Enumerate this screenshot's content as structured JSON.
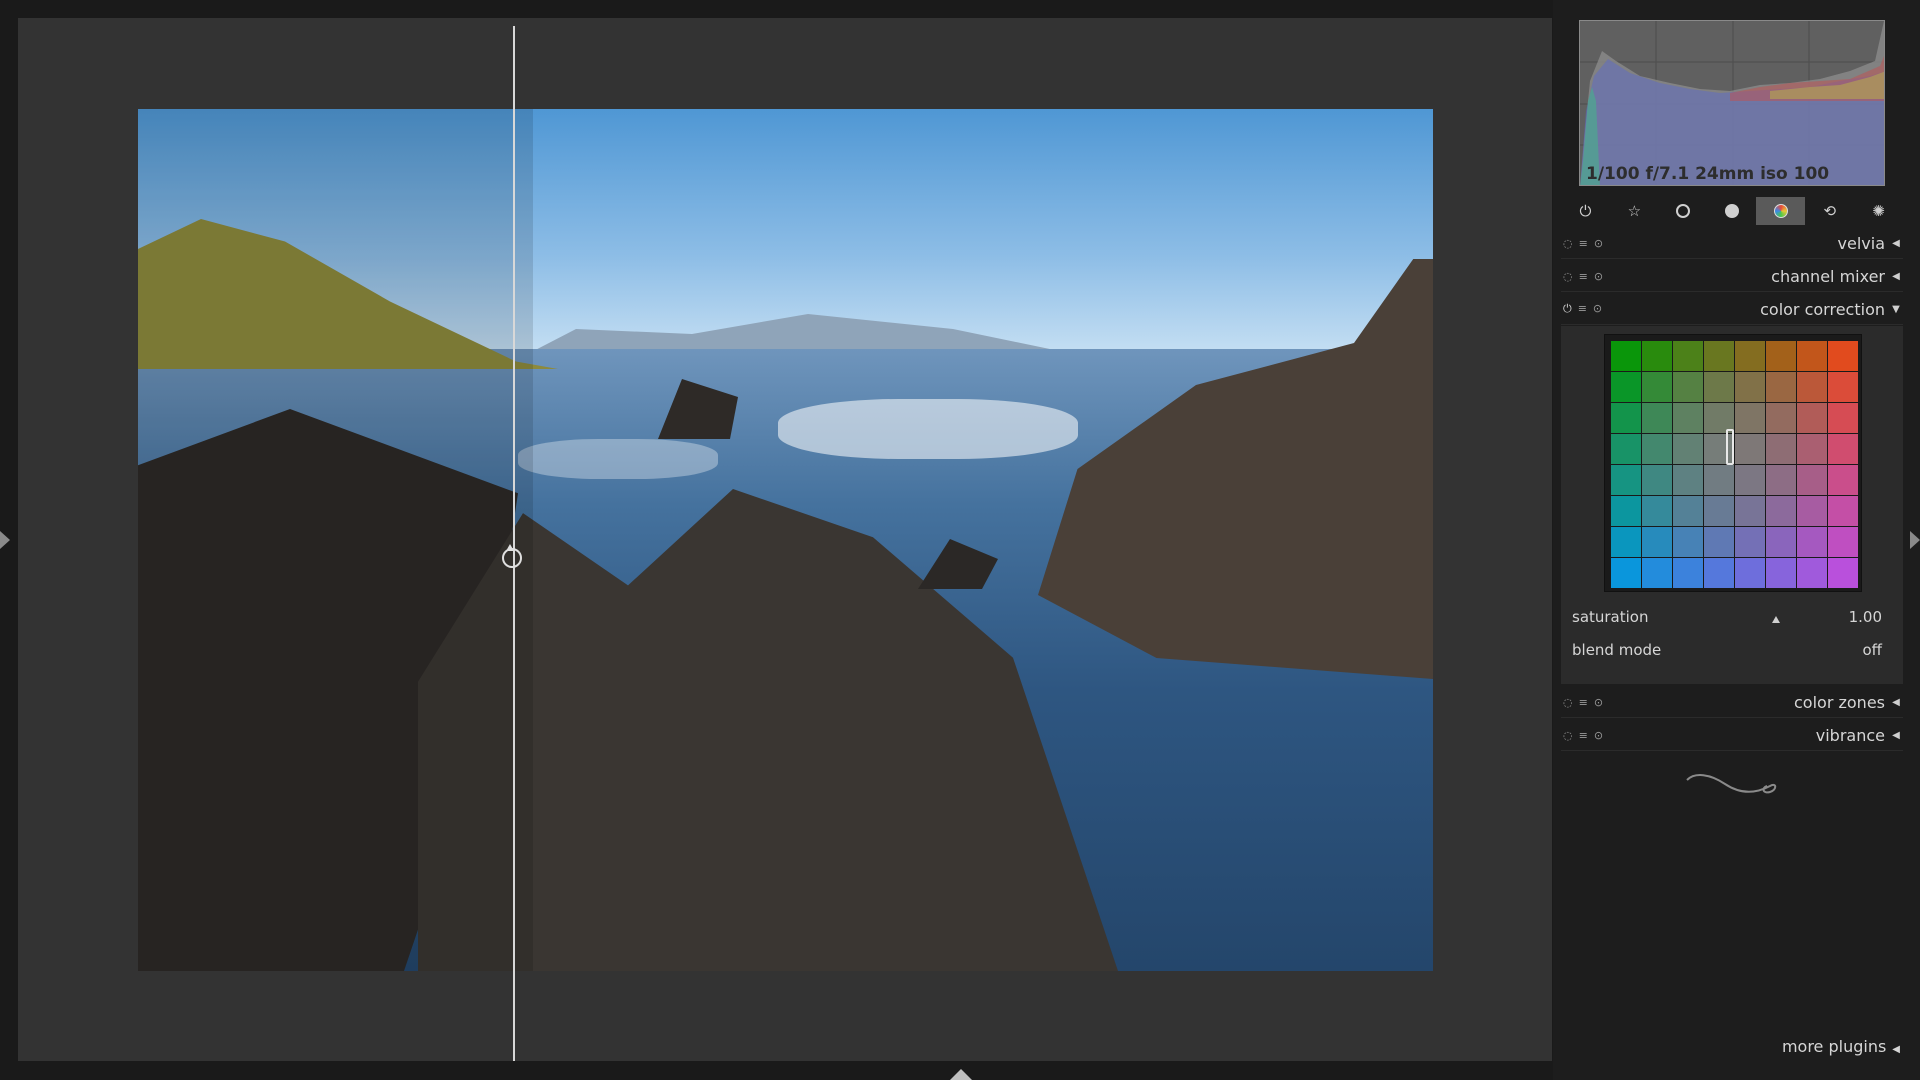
{
  "histogram": {
    "exif_info": "1/100 f/7.1 24mm iso 100"
  },
  "module_tabs": [
    {
      "icon": "power-icon",
      "glyph": "⏻"
    },
    {
      "icon": "star-icon",
      "glyph": "☆"
    },
    {
      "icon": "circle-outline-icon",
      "glyph": "○"
    },
    {
      "icon": "circle-filled-icon",
      "glyph": "●"
    },
    {
      "icon": "color-circle-icon",
      "glyph": "◉"
    },
    {
      "icon": "correct-icon",
      "glyph": "⟲"
    },
    {
      "icon": "effect-icon",
      "glyph": "✺"
    }
  ],
  "modules": [
    {
      "name": "velvia",
      "expanded": false
    },
    {
      "name": "channel mixer",
      "expanded": false
    },
    {
      "name": "color correction",
      "expanded": true
    },
    {
      "name": "color zones",
      "expanded": false
    },
    {
      "name": "vibrance",
      "expanded": false
    }
  ],
  "color_correction": {
    "saturation_label": "saturation",
    "saturation_value": "1.00",
    "blend_label": "blend mode",
    "blend_value": "off"
  },
  "more_plugins": "more plugins",
  "colors": {
    "active_tab": "#5a5a5a",
    "panel_bg": "#1d1d1d",
    "view_bg": "#333333"
  }
}
